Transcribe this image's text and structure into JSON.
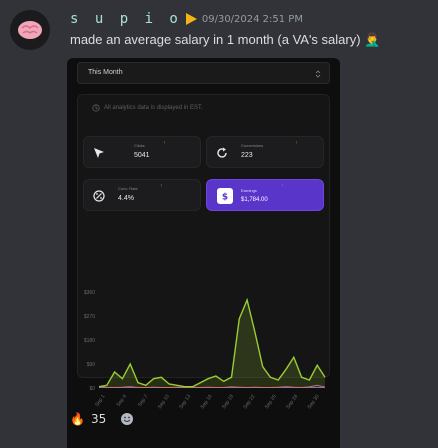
{
  "message": {
    "username": "s u p i o",
    "timestamp": "09/30/2024 2:51 PM",
    "text": "made an average salary in 1 month (a VA's salary) 🤦‍♂️"
  },
  "embed": {
    "period_select": "This Month",
    "info_text": "All analytics data is displayed in EST.",
    "cards": {
      "clicks": {
        "label": "Clicks",
        "value": "5041"
      },
      "conversions": {
        "label": "Conversions",
        "value": "223"
      },
      "conv_rate": {
        "label": "Conv. Rate",
        "value": "4.4%"
      },
      "earnings": {
        "label": "Earnings",
        "value": "$1,784.00"
      }
    }
  },
  "chart_data": {
    "type": "line",
    "y_ticks": [
      "$0",
      "$90",
      "$180",
      "$270",
      "$360"
    ],
    "ylim": [
      0,
      360
    ],
    "x_ticks": [
      "Sep 1",
      "Sep 4",
      "Sep 7",
      "Sep 10",
      "Sep 13",
      "Sep 16",
      "Sep 19",
      "Sep 22",
      "Sep 25",
      "Sep 28",
      "Sep 30"
    ],
    "series": [
      {
        "color": "#9acd32",
        "values": [
          5,
          10,
          60,
          35,
          90,
          20,
          10,
          35,
          40,
          15,
          10,
          5,
          5,
          20,
          35,
          45,
          25,
          40,
          260,
          330,
          210,
          80,
          40,
          30,
          70,
          115,
          40,
          30,
          85,
          40
        ]
      },
      {
        "color": "#d45b8a",
        "values": [
          5,
          3,
          2,
          3,
          5,
          2,
          2,
          3,
          2,
          2,
          3,
          2,
          3,
          2,
          3,
          2,
          2,
          4,
          3,
          2,
          3,
          2,
          2,
          3,
          5,
          3,
          2,
          4,
          10,
          3
        ]
      },
      {
        "color": "#6c6ce0",
        "values": [
          2,
          2,
          2,
          2,
          2,
          2,
          2,
          2,
          2,
          2,
          2,
          2,
          2,
          2,
          2,
          2,
          2,
          2,
          2,
          2,
          2,
          2,
          2,
          2,
          2,
          2,
          2,
          2,
          2,
          2
        ]
      }
    ]
  },
  "reactions": [
    {
      "emoji": "🔥",
      "count": "35"
    }
  ],
  "colors": {
    "accent_green": "#9acd32",
    "earnings_purple": "#5a35c9",
    "username": "#a8e0d8"
  }
}
